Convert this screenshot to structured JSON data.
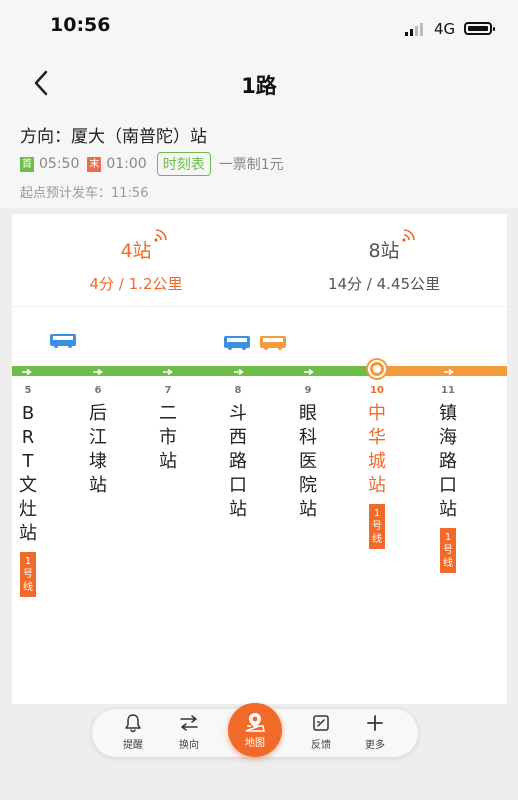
{
  "status_bar": {
    "time": "10:56",
    "network": "4G"
  },
  "header": {
    "title": "1路",
    "direction": "方向：厦大（南普陀）站",
    "first_tag": "首",
    "first_time": "05:50",
    "last_tag": "末",
    "last_time": "01:00",
    "schedule_label": "时刻表",
    "fare": "一票制1元",
    "departure": "起点预计发车：11:56"
  },
  "arrivals": [
    {
      "stops": "4站",
      "detail": "4分 / 1.2公里",
      "color": "#f06a2a"
    },
    {
      "stops": "8站",
      "detail": "14分 / 4.45公里",
      "color": "#555555"
    }
  ],
  "colors": {
    "accent": "#f06a2a",
    "line_green": "#6cbd4a",
    "line_orange": "#f39a3a",
    "bus_blue": "#3d8fe0",
    "bus_orange": "#f39a3a"
  },
  "stops": [
    {
      "num": "5",
      "name": "BRT文灶站",
      "badge": "1号线"
    },
    {
      "num": "6",
      "name": "后江埭站"
    },
    {
      "num": "7",
      "name": "二市站"
    },
    {
      "num": "8",
      "name": "斗西路口站"
    },
    {
      "num": "9",
      "name": "眼科医院站"
    },
    {
      "num": "10",
      "name": "中华城站",
      "badge": "1号线",
      "current": true
    },
    {
      "num": "11",
      "name": "镇海路口站",
      "badge": "1号线"
    }
  ],
  "nav": {
    "remind": "提醒",
    "reverse": "换向",
    "map": "地图",
    "feedback": "反馈",
    "more": "更多"
  }
}
